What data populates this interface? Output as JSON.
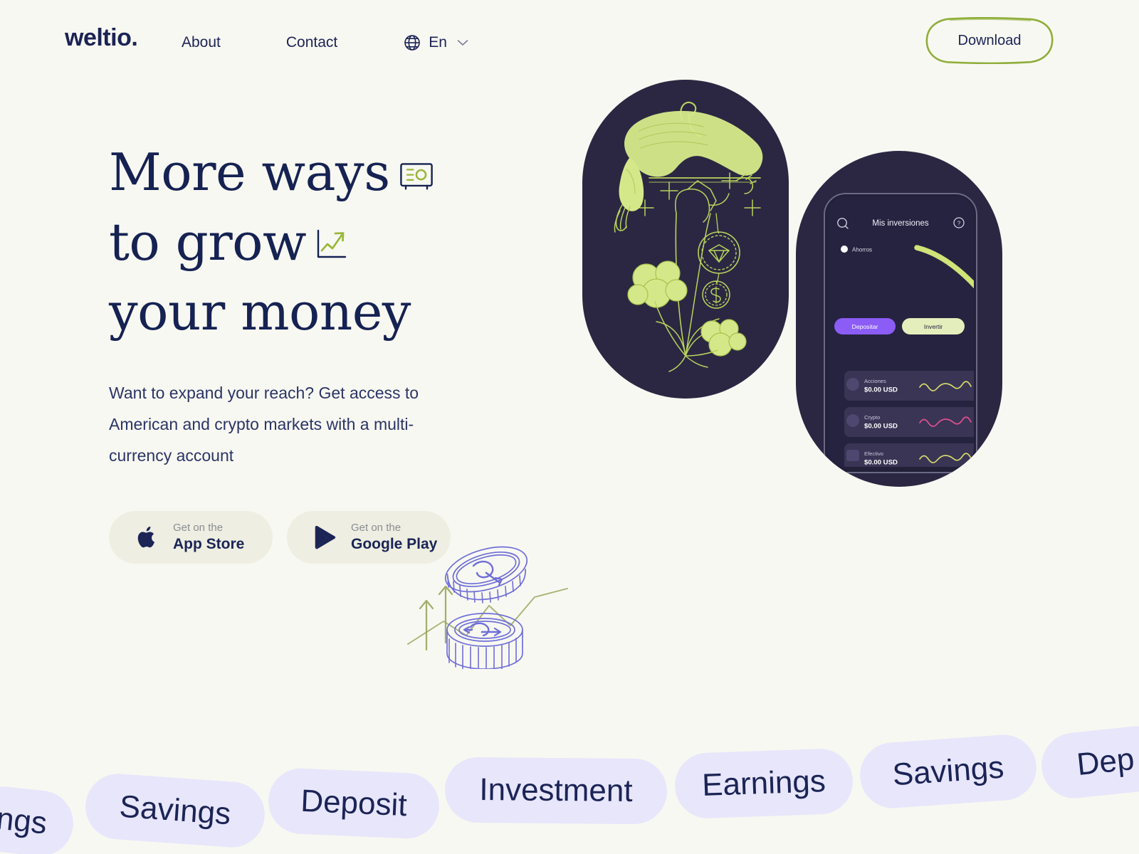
{
  "brand": {
    "logo": "weltio."
  },
  "nav": {
    "links": [
      {
        "label": "About",
        "name": "nav-link-about"
      },
      {
        "label": "Contact",
        "name": "nav-link-contact"
      }
    ],
    "language": {
      "label": "En",
      "icon": "globe-icon",
      "chevron": "chevron-down-icon"
    },
    "download_label": "Download"
  },
  "hero": {
    "headline_lines": [
      "More ways",
      "to grow",
      "your money"
    ],
    "headline_icons": [
      "safe-vault-icon",
      "growth-chart-icon"
    ],
    "subcopy": "Want to expand your reach? Get access to American and crypto markets with a multi-currency account",
    "stores": [
      {
        "top": "Get on the",
        "name": "App Store",
        "icon": "apple-icon"
      },
      {
        "top": "Get on the",
        "name": "Google Play",
        "icon": "google-play-icon"
      }
    ]
  },
  "phone": {
    "title": "Mis inversiones",
    "search_icon": "search-icon",
    "help_icon": "help-icon",
    "segment_label": "Ahorros",
    "actions": [
      {
        "label": "Depositar",
        "style": "primary"
      },
      {
        "label": "Invertir",
        "style": "secondary"
      }
    ],
    "holdings": [
      {
        "name": "Acciones",
        "amount": "$0.00 USD",
        "icon": "stocks-icon",
        "spark": "yellow"
      },
      {
        "name": "Crypto",
        "amount": "$0.00 USD",
        "icon": "crypto-icon",
        "spark": "pink"
      },
      {
        "name": "Efectivo",
        "amount": "$0.00 USD",
        "icon": "cash-icon",
        "spark": "yellow"
      }
    ]
  },
  "marquee": {
    "items": [
      "ngs",
      "Savings",
      "Deposit",
      "Investment",
      "Earnings",
      "Savings",
      "Dep"
    ]
  },
  "colors": {
    "background": "#f8f8f2",
    "navy": "#1b2455",
    "dark": "#262340",
    "green": "#d5e889",
    "olive": "#8fae3a",
    "purple": "#8b5cf6",
    "lavender": "#e7e6fb",
    "beige": "#eeeee2"
  }
}
